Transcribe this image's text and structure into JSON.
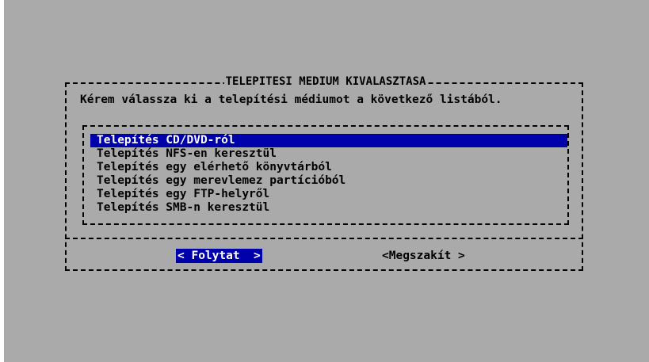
{
  "dialog": {
    "title": "TELEPITESI MEDIUM KIVALASZTASA",
    "prompt": "Kérem válassza ki a telepítési médiumot a következő listából."
  },
  "list": {
    "items": [
      {
        "label": "Telepítés CD/DVD-ról",
        "selected": true
      },
      {
        "label": "Telepítés NFS-en keresztül",
        "selected": false
      },
      {
        "label": "Telepítés egy elérhető könyvtárból",
        "selected": false
      },
      {
        "label": "Telepítés egy merevlemez partícióból",
        "selected": false
      },
      {
        "label": "Telepítés egy FTP-helyről",
        "selected": false
      },
      {
        "label": "Telepítés SMB-n keresztül",
        "selected": false
      }
    ]
  },
  "buttons": {
    "continue_label": "< Folytat  >",
    "abort_label": "<Megszakít >"
  },
  "colors": {
    "screen_bg": "#aaaaaa",
    "highlight_bg": "#0000aa",
    "highlight_fg": "#ffffff",
    "text": "#000000"
  }
}
